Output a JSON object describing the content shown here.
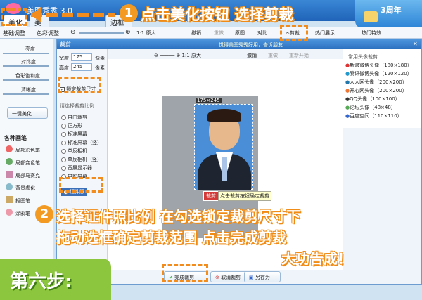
{
  "app": {
    "title": "美图秀秀 3.0"
  },
  "tabs": [
    "美化",
    "美容",
    "边框"
  ],
  "subtabs": [
    "基础调整",
    "色彩调整"
  ],
  "zoom_label": "1:1 原大",
  "toolbar_items": [
    "撤销",
    "重做",
    "原图",
    "对比",
    "剪裁"
  ],
  "right_tabs": [
    "热门展示",
    "热门特效"
  ],
  "sidebar": {
    "sliders": [
      "亮度",
      "对比度",
      "色彩饱和度",
      "清晰度"
    ],
    "one_click": "一键美化",
    "brushes_title": "各种画笔",
    "brushes": [
      "局部彩色笔",
      "局部变色笔",
      "局部马赛克",
      "背景虚化",
      "抠图笔",
      "涂鸦笔"
    ]
  },
  "dialog": {
    "title": "裁剪",
    "banner": "觉得美图秀秀好用，告诉朋友",
    "zoom_label": "1:1 原大",
    "toolbar": [
      "撤销",
      "重做",
      "重新开始"
    ],
    "width_label": "宽度",
    "width_value": "175",
    "height_label": "高度",
    "height_value": "245",
    "unit": "像素",
    "lock_label": "锁定裁剪尺寸",
    "ratio_title": "请选择裁剪比例",
    "ratios": [
      "自由裁剪",
      "正方形",
      "标准屏幕",
      "标准屏幕（竖）",
      "单反相机",
      "单反相机（竖）",
      "宽屏显示器",
      "电影屏幕",
      "证件照"
    ],
    "size_badge": "175×245",
    "crop_button": "裁剪",
    "crop_tip": "点击裁剪按钮确定裁剪",
    "buttons": {
      "done": "完成裁剪",
      "cancel": "取消裁剪",
      "save": "另存为"
    },
    "presets_title": "常用头像裁剪",
    "presets": [
      "新浪微博头像（180×180）",
      "腾讯微博头像（120×120）",
      "人人网头像（200×200）",
      "开心网头像（200×200）",
      "QQ头像（100×100）",
      "论坛头像（48×48）",
      "百度空间（110×110）"
    ]
  },
  "overlay": {
    "step1_num": "1",
    "step1_text": "点击美化按钮 选择剪裁",
    "step2_num": "2",
    "step2_line1": "选择证件照比例 在勾选锁定裁剪尺寸下",
    "step2_line2": "拖动选框确定剪裁范围 点击完成剪裁",
    "step2_line3": "大功告成！",
    "step_label": "第六步:",
    "banner_text": "3周年"
  }
}
